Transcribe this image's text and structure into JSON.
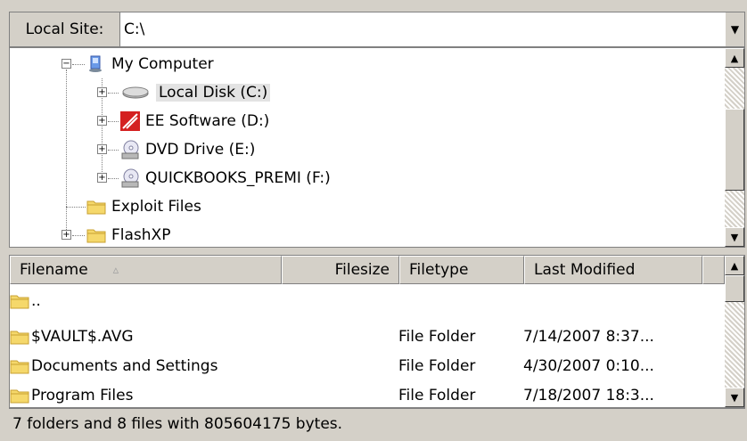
{
  "address": {
    "label": "Local Site:",
    "value": "C:\\"
  },
  "tree": {
    "items": [
      {
        "label": "My Computer",
        "icon": "computer-icon"
      },
      {
        "label": "Local Disk (C:)",
        "icon": "hard-disk-icon"
      },
      {
        "label": "EE Software (D:)",
        "icon": "ee-drive-icon"
      },
      {
        "label": "DVD Drive (E:)",
        "icon": "dvd-drive-icon"
      },
      {
        "label": "QUICKBOOKS_PREMI (F:)",
        "icon": "cd-drive-icon"
      },
      {
        "label": "Exploit Files",
        "icon": "folder-icon"
      },
      {
        "label": "FlashXP",
        "icon": "folder-icon"
      }
    ]
  },
  "files": {
    "columns": [
      "Filename",
      "Filesize",
      "Filetype",
      "Last Modified"
    ],
    "sort_indicator": "▵",
    "rows": [
      {
        "name": "..",
        "type": "",
        "modified": ""
      },
      {
        "name": "$VAULT$.AVG",
        "type": "File Folder",
        "modified": "7/14/2007 8:37..."
      },
      {
        "name": "Documents and Settings",
        "type": "File Folder",
        "modified": "4/30/2007 0:10..."
      },
      {
        "name": "Program Files",
        "type": "File Folder",
        "modified": "7/18/2007 18:3..."
      }
    ]
  },
  "status": {
    "text": "7 folders and 8 files with 805604175 bytes."
  },
  "colors": {
    "face": "#d4d0c8",
    "folder": "#f5d86b",
    "folder_dark": "#c8a030",
    "ee_red": "#d42020"
  }
}
